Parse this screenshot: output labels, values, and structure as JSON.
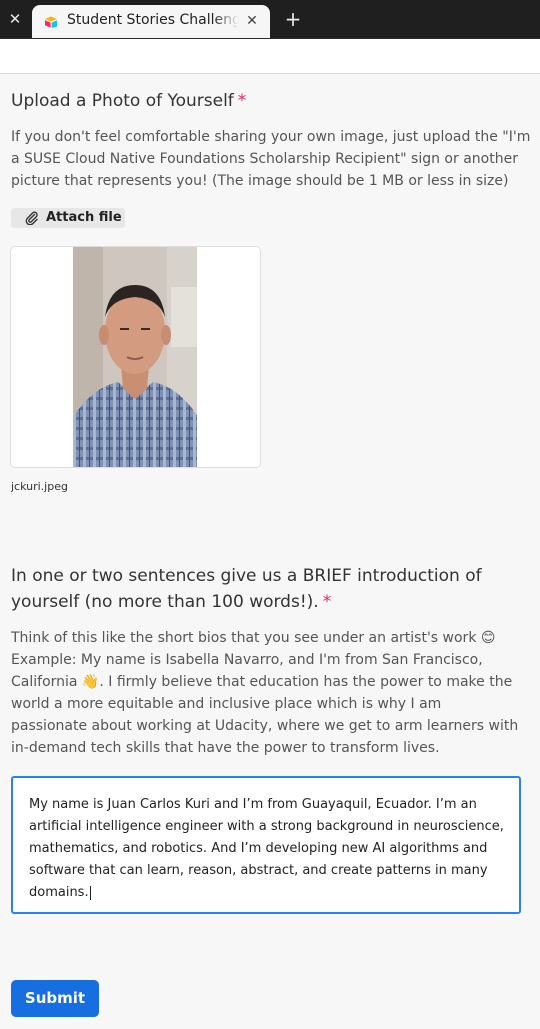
{
  "browser": {
    "tab_title": "Student Stories Challenge",
    "close_glyph": "✕",
    "tab_close_glyph": "✕",
    "new_tab_glyph": "+"
  },
  "photo_section": {
    "heading": "Upload a Photo of Yourself",
    "required_mark": "*",
    "description": "If you don't feel comfortable sharing your own image, just upload the \"I'm a SUSE Cloud Native Foundations Scholarship Recipient\" sign or another picture that represents you! (The image should be 1 MB or less in size)",
    "attach_label": "Attach file",
    "attach_icon": "paperclip-icon",
    "filename": "jckuri.jpeg"
  },
  "intro_section": {
    "heading": "In one or two sentences give us a BRIEF introduction of yourself (no more than 100 words!).",
    "required_mark": "*",
    "description": "Think of this like the short bios that you see under an artist's work 😊 Example: My name is Isabella Navarro, and I'm from San Francisco, California 👋. I firmly believe that education has the power to make the world a more equitable and inclusive place which is why I am passionate about working at Udacity, where we get to arm learners with in-demand tech skills that have the power to transform lives.",
    "answer": "My name is Juan Carlos Kuri and I’m from Guayaquil, Ecuador. I’m an artificial intelligence engineer with a strong background in neuroscience, mathematics, and robotics. And I’m developing new AI algorithms and software that can learn, reason, abstract, and create patterns in many domains."
  },
  "form": {
    "submit_label": "Submit"
  },
  "colors": {
    "accent": "#166ee1",
    "focus_border": "#2d7ff9",
    "required": "#e0245e"
  }
}
